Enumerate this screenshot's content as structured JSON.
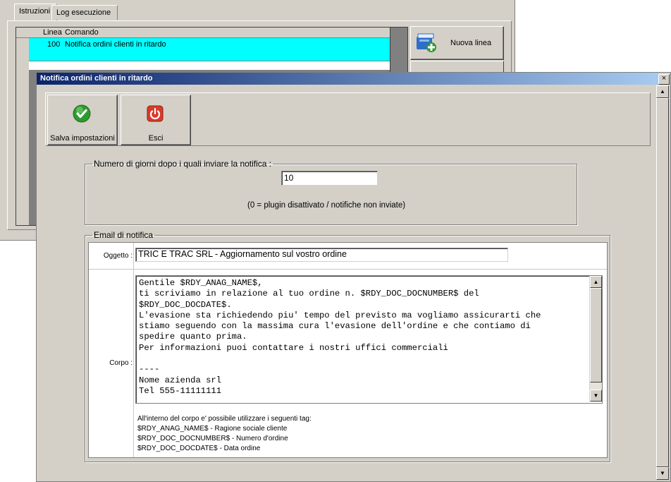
{
  "background_window": {
    "tabs": [
      "Istruzioni",
      "Log esecuzione"
    ],
    "grid": {
      "columns": [
        "Linea",
        "Comando"
      ],
      "rows": [
        {
          "linea": "100",
          "comando": "Notifica ordini clienti in ritardo"
        }
      ]
    },
    "new_line_button": "Nuova linea"
  },
  "dialog": {
    "title": "Notifica ordini clienti in ritardo",
    "close_glyph": "×",
    "toolbar": {
      "save_label": "Salva impostazioni",
      "exit_label": "Esci"
    },
    "days_group": {
      "legend": "Numero di giorni dopo i quali inviare la notifica :",
      "value": "10",
      "note": "(0 = plugin disattivato / notifiche non inviate)"
    },
    "email_group": {
      "legend": "Email di notifica",
      "subject_label": "Oggetto :",
      "subject_value": "TRIC E TRAC SRL - Aggiornamento sul vostro ordine",
      "body_label": "Corpo :",
      "body_value": "Gentile $RDY_ANAG_NAME$,\nti scriviamo in relazione al tuo ordine n. $RDY_DOC_DOCNUMBER$ del\n$RDY_DOC_DOCDATE$.\nL'evasione sta richiedendo piu' tempo del previsto ma vogliamo assicurarti che\nstiamo seguendo con la massima cura l'evasione dell'ordine e che contiamo di\nspedire quanto prima.\nPer informazioni puoi contattare i nostri uffici commerciali\n\n----\nNome azienda srl\nTel 555-11111111",
      "tags_intro": "All'interno del corpo e' possibile utilizzare i seguenti tag:",
      "tags": [
        "$RDY_ANAG_NAME$ - Ragione sociale cliente",
        "$RDY_DOC_DOCNUMBER$ - Numero d'ordine",
        "$RDY_DOC_DOCDATE$ - Data ordine"
      ]
    }
  },
  "colors": {
    "selected_row": "#00ffff",
    "titlebar": "#0a246a",
    "save_icon": "#2e9a2e",
    "exit_icon": "#d83a2a"
  },
  "icons": [
    "add-line-icon",
    "checkmark-icon",
    "power-off-icon"
  ]
}
